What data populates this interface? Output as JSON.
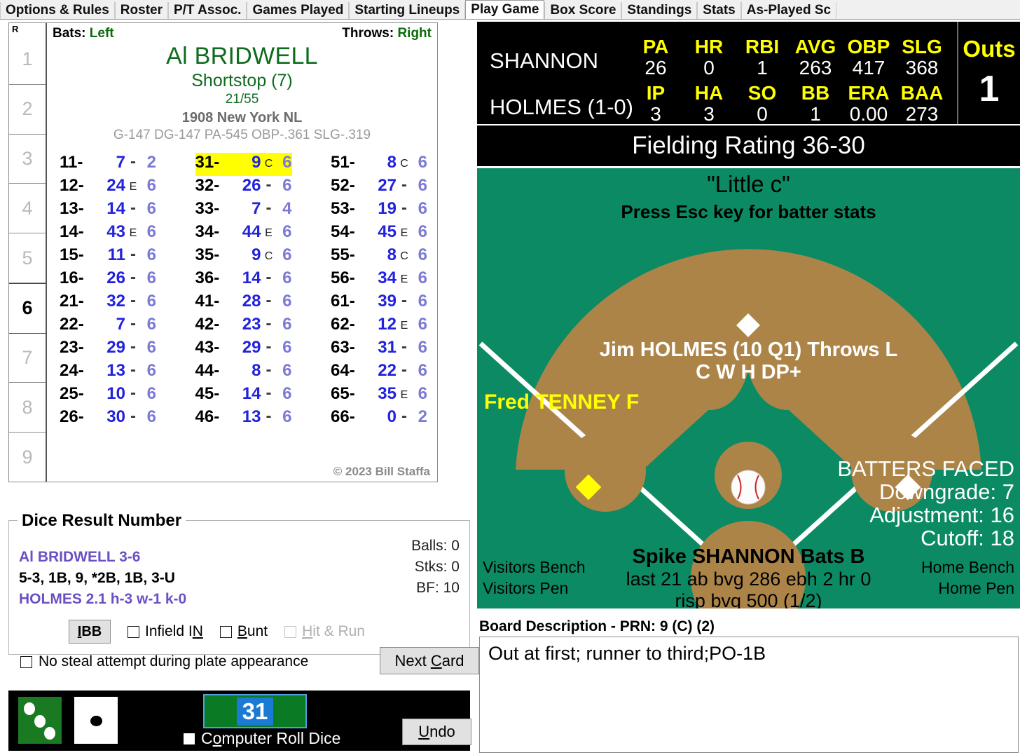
{
  "tabs": [
    {
      "label": "Options & Rules",
      "active": false
    },
    {
      "label": "Roster",
      "active": false
    },
    {
      "label": "P/T Assoc.",
      "active": false
    },
    {
      "label": "Games Played",
      "active": false
    },
    {
      "label": "Starting Lineups",
      "active": false
    },
    {
      "label": "Play Game",
      "active": true
    },
    {
      "label": "Box Score",
      "active": false
    },
    {
      "label": "Standings",
      "active": false
    },
    {
      "label": "Stats",
      "active": false
    },
    {
      "label": "As-Played Sc",
      "active": false
    }
  ],
  "innings": {
    "header": "R",
    "cells": [
      "1",
      "2",
      "3",
      "4",
      "5",
      "6",
      "7",
      "8",
      "9"
    ],
    "current": "6"
  },
  "player_card": {
    "bats_label": "Bats:",
    "bats_value": "Left",
    "throws_label": "Throws:",
    "throws_value": "Right",
    "name": "Al BRIDWELL",
    "position": "Shortstop (7)",
    "fraction": "21/55",
    "team": "1908 New York NL",
    "stat_line": "G-147 DG-147 PA-545 OBP-.361 SLG-.319",
    "copyright": "© 2023 Bill Staffa",
    "columns": [
      [
        {
          "key": "11-",
          "res": "7",
          "flag": "-",
          "num": "2",
          "hl": false
        },
        {
          "key": "12-",
          "res": "24",
          "flag": "E",
          "num": "6",
          "hl": false
        },
        {
          "key": "13-",
          "res": "14",
          "flag": "-",
          "num": "6",
          "hl": false
        },
        {
          "key": "14-",
          "res": "43",
          "flag": "E",
          "num": "6",
          "hl": false
        },
        {
          "key": "15-",
          "res": "11",
          "flag": "-",
          "num": "6",
          "hl": false
        },
        {
          "key": "16-",
          "res": "26",
          "flag": "-",
          "num": "6",
          "hl": false
        },
        {
          "key": "21-",
          "res": "32",
          "flag": "-",
          "num": "6",
          "hl": false
        },
        {
          "key": "22-",
          "res": "7",
          "flag": "-",
          "num": "6",
          "hl": false
        },
        {
          "key": "23-",
          "res": "29",
          "flag": "-",
          "num": "6",
          "hl": false
        },
        {
          "key": "24-",
          "res": "13",
          "flag": "-",
          "num": "6",
          "hl": false
        },
        {
          "key": "25-",
          "res": "10",
          "flag": "-",
          "num": "6",
          "hl": false
        },
        {
          "key": "26-",
          "res": "30",
          "flag": "-",
          "num": "6",
          "hl": false
        }
      ],
      [
        {
          "key": "31-",
          "res": "9",
          "flag": "C",
          "num": "6",
          "hl": true
        },
        {
          "key": "32-",
          "res": "26",
          "flag": "-",
          "num": "6",
          "hl": false
        },
        {
          "key": "33-",
          "res": "7",
          "flag": "-",
          "num": "4",
          "hl": false
        },
        {
          "key": "34-",
          "res": "44",
          "flag": "E",
          "num": "6",
          "hl": false
        },
        {
          "key": "35-",
          "res": "9",
          "flag": "C",
          "num": "6",
          "hl": false
        },
        {
          "key": "36-",
          "res": "14",
          "flag": "-",
          "num": "6",
          "hl": false
        },
        {
          "key": "41-",
          "res": "28",
          "flag": "-",
          "num": "6",
          "hl": false
        },
        {
          "key": "42-",
          "res": "23",
          "flag": "-",
          "num": "6",
          "hl": false
        },
        {
          "key": "43-",
          "res": "29",
          "flag": "-",
          "num": "6",
          "hl": false
        },
        {
          "key": "44-",
          "res": "8",
          "flag": "-",
          "num": "6",
          "hl": false
        },
        {
          "key": "45-",
          "res": "14",
          "flag": "-",
          "num": "6",
          "hl": false
        },
        {
          "key": "46-",
          "res": "13",
          "flag": "-",
          "num": "6",
          "hl": false
        }
      ],
      [
        {
          "key": "51-",
          "res": "8",
          "flag": "C",
          "num": "6",
          "hl": false
        },
        {
          "key": "52-",
          "res": "27",
          "flag": "-",
          "num": "6",
          "hl": false
        },
        {
          "key": "53-",
          "res": "19",
          "flag": "-",
          "num": "6",
          "hl": false
        },
        {
          "key": "54-",
          "res": "45",
          "flag": "E",
          "num": "6",
          "hl": false
        },
        {
          "key": "55-",
          "res": "8",
          "flag": "C",
          "num": "6",
          "hl": false
        },
        {
          "key": "56-",
          "res": "34",
          "flag": "E",
          "num": "6",
          "hl": false
        },
        {
          "key": "61-",
          "res": "39",
          "flag": "-",
          "num": "6",
          "hl": false
        },
        {
          "key": "62-",
          "res": "12",
          "flag": "E",
          "num": "6",
          "hl": false
        },
        {
          "key": "63-",
          "res": "31",
          "flag": "-",
          "num": "6",
          "hl": false
        },
        {
          "key": "64-",
          "res": "22",
          "flag": "-",
          "num": "6",
          "hl": false
        },
        {
          "key": "65-",
          "res": "35",
          "flag": "E",
          "num": "6",
          "hl": false
        },
        {
          "key": "66-",
          "res": "0",
          "flag": "-",
          "num": "2",
          "hl": false
        }
      ]
    ]
  },
  "scoreboard": {
    "batter_name": "SHANNON",
    "batter_headers": [
      "PA",
      "HR",
      "RBI",
      "AVG",
      "OBP",
      "SLG"
    ],
    "batter_values": [
      "26",
      "0",
      "1",
      "263",
      "417",
      "368"
    ],
    "pitcher_name": "HOLMES (1-0)",
    "pitcher_headers": [
      "IP",
      "HA",
      "SO",
      "BB",
      "ERA",
      "BAA"
    ],
    "pitcher_values": [
      "3",
      "3",
      "0",
      "1",
      "0.00",
      "273"
    ],
    "outs_label": "Outs",
    "outs_value": "1",
    "fielding_rating": "Fielding Rating 36-30"
  },
  "field": {
    "little_c": "\"Little c\"",
    "esc_hint": "Press Esc key for batter stats",
    "pitcher_line1": "Jim HOLMES (10 Q1) Throws L",
    "pitcher_line2": "C W H DP+",
    "runner_first": "Fred TENNEY F",
    "bf_title": "BATTERS FACED",
    "bf_downgrade": "Downgrade: 7",
    "bf_adjustment": "Adjustment: 16",
    "bf_cutoff": "Cutoff: 18",
    "batter_line1": "Spike SHANNON Bats B",
    "batter_line2": "last 21 ab bvg 286 ebh 2 hr 0",
    "batter_line3": "risp bvg 500 (1/2)",
    "visitors_bench": "Visitors Bench",
    "visitors_pen": "Visitors Pen",
    "home_bench": "Home Bench",
    "home_pen": "Home Pen",
    "grass_color": "#0b8a63",
    "dirt_color": "#ad8448"
  },
  "dice_panel": {
    "title": "Dice Result Number",
    "batter_line": "Al BRIDWELL  3-6",
    "result_line": "5-3, 1B, 9, *2B, 1B, 3-U",
    "pitcher_line": "HOLMES  2.1  h-3  w-1  k-0",
    "balls": "Balls: 0",
    "strikes": "Stks: 0",
    "bf": "BF: 10",
    "ibb_label": "IBB",
    "infield_in_label": "Infield IN",
    "bunt_label": "Bunt",
    "hit_run_label": "Hit & Run",
    "no_steal_label": "No steal attempt during plate appearance",
    "next_card_label": "Next Card"
  },
  "dice_strip": {
    "die1_value": "3",
    "die2_value": "1",
    "roll_value": "31",
    "computer_roll_label": "Computer Roll Dice",
    "undo_label": "Undo"
  },
  "board": {
    "label": "Board Description - PRN: 9 (C) (2)",
    "description": "Out at first; runner to third;PO-1B"
  }
}
